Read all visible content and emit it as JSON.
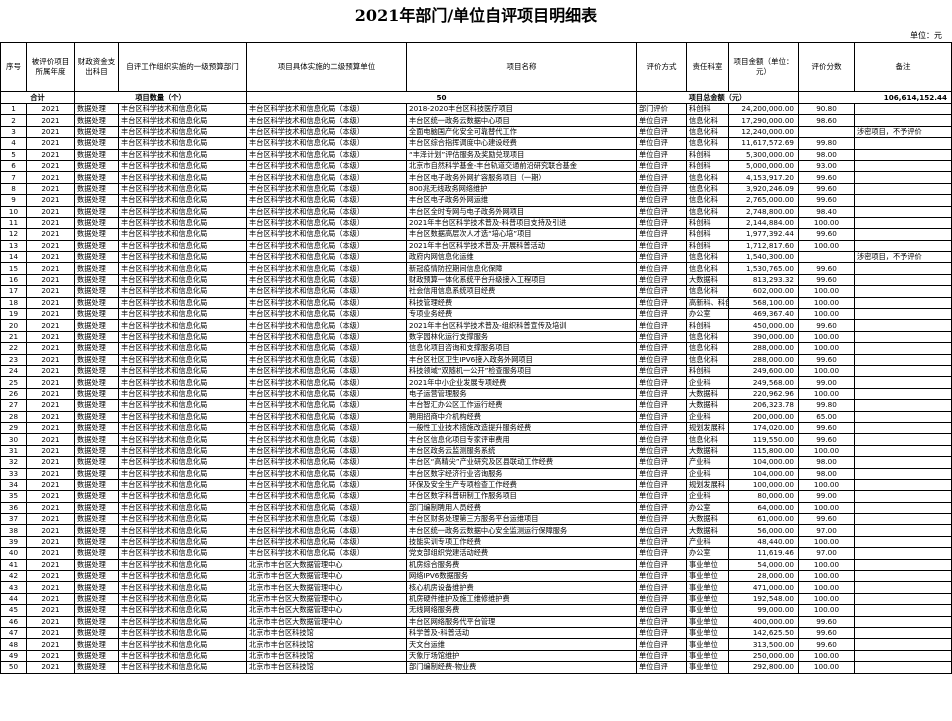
{
  "title": "2021年部门/单位自评项目明细表",
  "unit_label": "单位：元",
  "headers": [
    "序号",
    "被评价项目所属年度",
    "财政资金支出科目",
    "自评工作组织实施的一级预算部门",
    "项目具体实施的二级预算单位",
    "项目名称",
    "评价方式",
    "责任科室",
    "项目金额（单位：元）",
    "评价分数",
    "备注"
  ],
  "summary": {
    "label": "合计",
    "count_label": "项目数量（个）",
    "count": "50",
    "amount_label": "项目总金额（元）",
    "amount": "106,614,152.44"
  },
  "rows": [
    [
      "1",
      "2021",
      "数据处理",
      "丰台区科学技术和信息化局",
      "丰台区科学技术和信息化局（本级）",
      "2018-2020丰台区科技医疗项目",
      "部门评价",
      "科创科",
      "24,200,000.00",
      "90.80",
      ""
    ],
    [
      "2",
      "2021",
      "数据处理",
      "丰台区科学技术和信息化局",
      "丰台区科学技术和信息化局（本级）",
      "丰台区统一政务云数据中心项目",
      "单位自评",
      "信息化科",
      "17,290,000.00",
      "98.60",
      ""
    ],
    [
      "3",
      "2021",
      "数据处理",
      "丰台区科学技术和信息化局",
      "丰台区科学技术和信息化局（本级）",
      "全面电脑国产化安全可靠替代工作",
      "单位自评",
      "信息化科",
      "12,240,000.00",
      "",
      "涉密项目，不予评价"
    ],
    [
      "4",
      "2021",
      "数据处理",
      "丰台区科学技术和信息化局",
      "丰台区科学技术和信息化局（本级）",
      "丰台区综合指挥调度中心建设经费",
      "单位自评",
      "信息化科",
      "11,617,572.69",
      "99.80",
      ""
    ],
    [
      "5",
      "2021",
      "数据处理",
      "丰台区科学技术和信息化局",
      "丰台区科学技术和信息化局（本级）",
      "“丰泽计划”评估服务及奖励兑现项目",
      "单位自评",
      "科创科",
      "5,300,000.00",
      "98.00",
      ""
    ],
    [
      "6",
      "2021",
      "数据处理",
      "丰台区科学技术和信息化局",
      "丰台区科学技术和信息化局（本级）",
      "北京市自然科学基金-丰台轨道交通前沿研究联合基金",
      "单位自评",
      "科创科",
      "5,000,000.00",
      "93.00",
      ""
    ],
    [
      "7",
      "2021",
      "数据处理",
      "丰台区科学技术和信息化局",
      "丰台区科学技术和信息化局（本级）",
      "丰台区电子政务外网扩容服务项目（一期）",
      "单位自评",
      "信息化科",
      "4,153,917.20",
      "99.60",
      ""
    ],
    [
      "8",
      "2021",
      "数据处理",
      "丰台区科学技术和信息化局",
      "丰台区科学技术和信息化局（本级）",
      "800兆无线政务网络维护",
      "单位自评",
      "信息化科",
      "3,920,246.09",
      "99.60",
      ""
    ],
    [
      "9",
      "2021",
      "数据处理",
      "丰台区科学技术和信息化局",
      "丰台区科学技术和信息化局（本级）",
      "丰台区电子政务外网运维",
      "单位自评",
      "信息化科",
      "2,765,000.00",
      "99.60",
      ""
    ],
    [
      "10",
      "2021",
      "数据处理",
      "丰台区科学技术和信息化局",
      "丰台区科学技术和信息化局（本级）",
      "丰台区全时专网与电子政务外网项目",
      "单位自评",
      "信息化科",
      "2,748,800.00",
      "98.40",
      ""
    ],
    [
      "11",
      "2021",
      "数据处理",
      "丰台区科学技术和信息化局",
      "丰台区科学技术和信息化局（本级）",
      "2021年丰台区科学技术普及-科普项目支持及引进",
      "单位自评",
      "科创科",
      "2,144,884.00",
      "100.00",
      ""
    ],
    [
      "12",
      "2021",
      "数据处理",
      "丰台区科学技术和信息化局",
      "丰台区科学技术和信息化局（本级）",
      "丰台区数据高层次人才选“培心培”项目",
      "单位自评",
      "科创科",
      "1,977,392.44",
      "99.60",
      ""
    ],
    [
      "13",
      "2021",
      "数据处理",
      "丰台区科学技术和信息化局",
      "丰台区科学技术和信息化局（本级）",
      "2021年丰台区科学技术普及-开展科普活动",
      "单位自评",
      "科创科",
      "1,712,817.60",
      "100.00",
      ""
    ],
    [
      "14",
      "2021",
      "数据处理",
      "丰台区科学技术和信息化局",
      "丰台区科学技术和信息化局（本级）",
      "政府内网信息化运维",
      "单位自评",
      "信息化科",
      "1,540,300.00",
      "",
      "涉密项目，不予评价"
    ],
    [
      "15",
      "2021",
      "数据处理",
      "丰台区科学技术和信息化局",
      "丰台区科学技术和信息化局（本级）",
      "新冠疫情防控期间信息化保障",
      "单位自评",
      "信息化科",
      "1,530,765.00",
      "99.60",
      ""
    ],
    [
      "16",
      "2021",
      "数据处理",
      "丰台区科学技术和信息化局",
      "丰台区科学技术和信息化局（本级）",
      "财政预算一体化系统平台升级接入工程项目",
      "单位自评",
      "大数据科",
      "813,293.32",
      "99.60",
      ""
    ],
    [
      "17",
      "2021",
      "数据处理",
      "丰台区科学技术和信息化局",
      "丰台区科学技术和信息化局（本级）",
      "社会信用信息系统项目经费",
      "单位自评",
      "信息化科",
      "602,000.00",
      "100.00",
      ""
    ],
    [
      "18",
      "2021",
      "数据处理",
      "丰台区科学技术和信息化局",
      "丰台区科学技术和信息化局（本级）",
      "科技管理经费",
      "单位自评",
      "高新科、科创科",
      "568,100.00",
      "100.00",
      ""
    ],
    [
      "19",
      "2021",
      "数据处理",
      "丰台区科学技术和信息化局",
      "丰台区科学技术和信息化局（本级）",
      "专项业务经费",
      "单位自评",
      "办公室",
      "469,367.40",
      "100.00",
      ""
    ],
    [
      "20",
      "2021",
      "数据处理",
      "丰台区科学技术和信息化局",
      "丰台区科学技术和信息化局（本级）",
      "2021年丰台区科学技术普及-组织科普宣传及培训",
      "单位自评",
      "科创科",
      "450,000.00",
      "99.60",
      ""
    ],
    [
      "21",
      "2021",
      "数据处理",
      "丰台区科学技术和信息化局",
      "丰台区科学技术和信息化局（本级）",
      "数字园林化运行支撑服务",
      "单位自评",
      "信息化科",
      "390,000.00",
      "100.00",
      ""
    ],
    [
      "22",
      "2021",
      "数据处理",
      "丰台区科学技术和信息化局",
      "丰台区科学技术和信息化局（本级）",
      "信息化项目咨询和支撑服务项目",
      "单位自评",
      "信息化科",
      "288,000.00",
      "100.00",
      ""
    ],
    [
      "23",
      "2021",
      "数据处理",
      "丰台区科学技术和信息化局",
      "丰台区科学技术和信息化局（本级）",
      "丰台区社区卫生IPV6接入政务外网项目",
      "单位自评",
      "信息化科",
      "288,000.00",
      "99.60",
      ""
    ],
    [
      "24",
      "2021",
      "数据处理",
      "丰台区科学技术和信息化局",
      "丰台区科学技术和信息化局（本级）",
      "科技领域“双随机一公开”检查服务项目",
      "单位自评",
      "科创科",
      "249,600.00",
      "100.00",
      ""
    ],
    [
      "25",
      "2021",
      "数据处理",
      "丰台区科学技术和信息化局",
      "丰台区科学技术和信息化局（本级）",
      "2021年中小企业发展专项经费",
      "单位自评",
      "企业科",
      "249,568.00",
      "99.00",
      ""
    ],
    [
      "26",
      "2021",
      "数据处理",
      "丰台区科学技术和信息化局",
      "丰台区科学技术和信息化局（本级）",
      "电子运营管理服务",
      "单位自评",
      "大数据科",
      "220,962.96",
      "100.00",
      ""
    ],
    [
      "27",
      "2021",
      "数据处理",
      "丰台区科学技术和信息化局",
      "丰台区科学技术和信息化局（本级）",
      "丰台智汇办公区工作运行经费",
      "单位自评",
      "大数据科",
      "206,323.78",
      "99.80",
      ""
    ],
    [
      "28",
      "2021",
      "数据处理",
      "丰台区科学技术和信息化局",
      "丰台区科学技术和信息化局（本级）",
      "聘用招商中介机构经费",
      "单位自评",
      "企业科",
      "200,000.00",
      "65.00",
      ""
    ],
    [
      "29",
      "2021",
      "数据处理",
      "丰台区科学技术和信息化局",
      "丰台区科学技术和信息化局（本级）",
      "一般性工业技术措施改造提升服务经费",
      "单位自评",
      "规划发展科",
      "174,020.00",
      "99.60",
      ""
    ],
    [
      "30",
      "2021",
      "数据处理",
      "丰台区科学技术和信息化局",
      "丰台区科学技术和信息化局（本级）",
      "丰台区信息化项目专家评审费用",
      "单位自评",
      "信息化科",
      "119,550.00",
      "99.60",
      ""
    ],
    [
      "31",
      "2021",
      "数据处理",
      "丰台区科学技术和信息化局",
      "丰台区科学技术和信息化局（本级）",
      "丰台区政务云监测服务系统",
      "单位自评",
      "大数据科",
      "115,800.00",
      "100.00",
      ""
    ],
    [
      "32",
      "2021",
      "数据处理",
      "丰台区科学技术和信息化局",
      "丰台区科学技术和信息化局（本级）",
      "丰台区“高精尖”产业研究及区县联动工作经费",
      "单位自评",
      "产业科",
      "104,000.00",
      "98.00",
      ""
    ],
    [
      "33",
      "2021",
      "数据处理",
      "丰台区科学技术和信息化局",
      "丰台区科学技术和信息化局（本级）",
      "丰台区数字经济行业咨询服务",
      "单位自评",
      "企业科",
      "104,000.00",
      "98.00",
      ""
    ],
    [
      "34",
      "2021",
      "数据处理",
      "丰台区科学技术和信息化局",
      "丰台区科学技术和信息化局（本级）",
      "环保及安全生产专项检查工作经费",
      "单位自评",
      "规划发展科",
      "100,000.00",
      "100.00",
      ""
    ],
    [
      "35",
      "2021",
      "数据处理",
      "丰台区科学技术和信息化局",
      "丰台区科学技术和信息化局（本级）",
      "丰台区数字科普研制工作服务项目",
      "单位自评",
      "企业科",
      "80,000.00",
      "99.00",
      ""
    ],
    [
      "36",
      "2021",
      "数据处理",
      "丰台区科学技术和信息化局",
      "丰台区科学技术和信息化局（本级）",
      "部门编制聘用人员经费",
      "单位自评",
      "办公室",
      "64,000.00",
      "100.00",
      ""
    ],
    [
      "37",
      "2021",
      "数据处理",
      "丰台区科学技术和信息化局",
      "丰台区科学技术和信息化局（本级）",
      "丰台区财务处理第三方服务平台运维项目",
      "单位自评",
      "大数据科",
      "61,000.00",
      "99.60",
      ""
    ],
    [
      "38",
      "2021",
      "数据处理",
      "丰台区科学技术和信息化局",
      "丰台区科学技术和信息化局（本级）",
      "丰台区统一政务云数据中心安全监测运行保障服务",
      "单位自评",
      "大数据科",
      "56,000.00",
      "97.00",
      ""
    ],
    [
      "39",
      "2021",
      "数据处理",
      "丰台区科学技术和信息化局",
      "丰台区科学技术和信息化局（本级）",
      "技能实训专项工作经费",
      "单位自评",
      "产业科",
      "48,440.00",
      "100.00",
      ""
    ],
    [
      "40",
      "2021",
      "数据处理",
      "丰台区科学技术和信息化局",
      "丰台区科学技术和信息化局（本级）",
      "党支部组织党建活动经费",
      "单位自评",
      "办公室",
      "11,619.46",
      "97.00",
      ""
    ],
    [
      "41",
      "2021",
      "数据处理",
      "丰台区科学技术和信息化局",
      "北京市丰台区大数据管理中心",
      "机房综合服务费",
      "单位自评",
      "事业单位",
      "54,000.00",
      "100.00",
      ""
    ],
    [
      "42",
      "2021",
      "数据处理",
      "丰台区科学技术和信息化局",
      "北京市丰台区大数据管理中心",
      "网络IPV6数据服务",
      "单位自评",
      "事业单位",
      "28,000.00",
      "100.00",
      ""
    ],
    [
      "43",
      "2021",
      "数据处理",
      "丰台区科学技术和信息化局",
      "北京市丰台区大数据管理中心",
      "核心机房设备维护费",
      "单位自评",
      "事业单位",
      "471,000.00",
      "100.00",
      ""
    ],
    [
      "44",
      "2021",
      "数据处理",
      "丰台区科学技术和信息化局",
      "北京市丰台区大数据管理中心",
      "机房硬件维护及施工维修维护费",
      "单位自评",
      "事业单位",
      "192,548.00",
      "100.00",
      ""
    ],
    [
      "45",
      "2021",
      "数据处理",
      "丰台区科学技术和信息化局",
      "北京市丰台区大数据管理中心",
      "无线网络服务费",
      "单位自评",
      "事业单位",
      "99,000.00",
      "100.00",
      ""
    ],
    [
      "46",
      "2021",
      "数据处理",
      "丰台区科学技术和信息化局",
      "北京市丰台区大数据管理中心",
      "丰台区网络服务代平台管理",
      "单位自评",
      "事业单位",
      "400,000.00",
      "99.60",
      ""
    ],
    [
      "47",
      "2021",
      "数据处理",
      "丰台区科学技术和信息化局",
      "北京市丰台区科技馆",
      "科学普及-科普活动",
      "单位自评",
      "事业单位",
      "142,625.50",
      "99.60",
      ""
    ],
    [
      "48",
      "2021",
      "数据处理",
      "丰台区科学技术和信息化局",
      "北京市丰台区科技馆",
      "天文台运维",
      "单位自评",
      "事业单位",
      "313,500.00",
      "99.60",
      ""
    ],
    [
      "49",
      "2021",
      "数据处理",
      "丰台区科学技术和信息化局",
      "北京市丰台区科技馆",
      "天象厅场馆维护",
      "单位自评",
      "事业单位",
      "250,000.00",
      "100.00",
      ""
    ],
    [
      "50",
      "2021",
      "数据处理",
      "丰台区科学技术和信息化局",
      "北京市丰台区科技馆",
      "部门编制经费-物业费",
      "单位自评",
      "事业单位",
      "292,800.00",
      "100.00",
      ""
    ]
  ]
}
